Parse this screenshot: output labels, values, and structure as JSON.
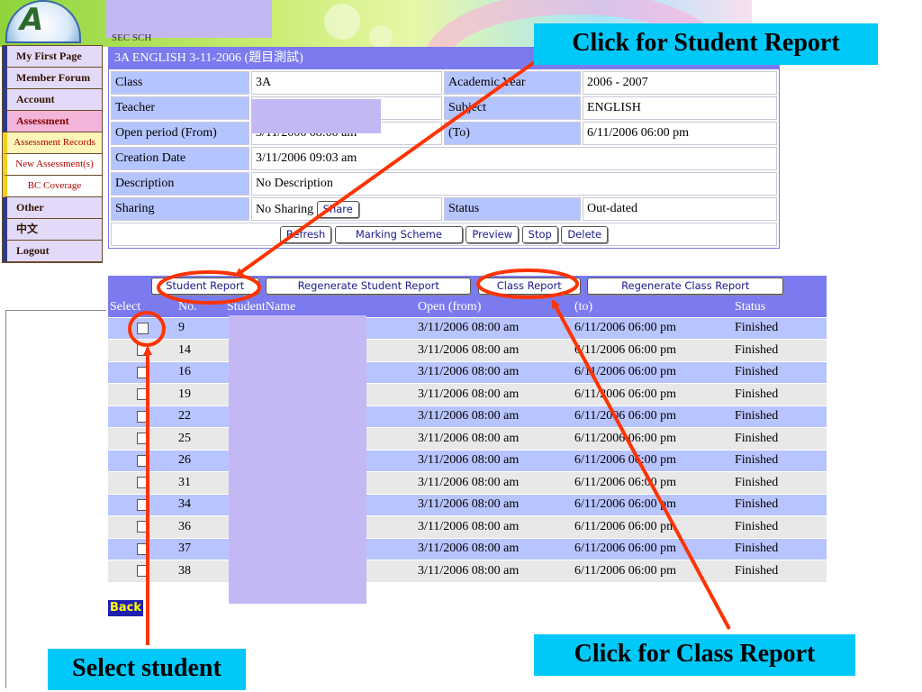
{
  "header": {
    "school_tag": "SEC SCH",
    "logo_text": "A"
  },
  "sidebar": {
    "items": [
      {
        "label": "My First Page"
      },
      {
        "label": "Member Forum"
      },
      {
        "label": "Account"
      },
      {
        "label": "Assessment"
      },
      {
        "label": "Assessment Records"
      },
      {
        "label": "New Assessment(s)"
      },
      {
        "label": "BC Coverage"
      },
      {
        "label": "Other"
      },
      {
        "label": "中文"
      },
      {
        "label": "Logout"
      }
    ]
  },
  "assessment": {
    "title": "3A ENGLISH 3-11-2006 (題目測試)",
    "class_label": "Class",
    "class_value": "3A",
    "year_label": "Academic Year",
    "year_value": "2006 - 2007",
    "teacher_label": "Teacher",
    "teacher_value": "",
    "subject_label": "Subject",
    "subject_value": "ENGLISH",
    "open_from_label": "Open period (From)",
    "open_from_value": "3/11/2006 08:00 am",
    "to_label": "(To)",
    "to_value": "6/11/2006 06:00 pm",
    "creation_label": "Creation Date",
    "creation_value": "3/11/2006 09:03 am",
    "description_label": "Description",
    "description_value": "No Description",
    "sharing_label": "Sharing",
    "sharing_value": "No Sharing",
    "share_button": "Share",
    "status_label": "Status",
    "status_value": "Out-dated",
    "buttons": {
      "refresh": "Refresh",
      "marking_scheme": "Marking Scheme",
      "preview": "Preview",
      "stop": "Stop",
      "delete": "Delete"
    }
  },
  "list": {
    "buttons": {
      "student_report": "Student Report",
      "regen_student": "Regenerate Student Report",
      "class_report": "Class Report",
      "regen_class": "Regenerate Class Report"
    },
    "columns": [
      "Select",
      "No.",
      "StudentName",
      "Open (from)",
      "(to)",
      "Status"
    ],
    "rows": [
      {
        "no": "9",
        "open": "3/11/2006 08:00 am",
        "to": "6/11/2006 06:00 pm",
        "status": "Finished"
      },
      {
        "no": "14",
        "open": "3/11/2006 08:00 am",
        "to": "6/11/2006 06:00 pm",
        "status": "Finished"
      },
      {
        "no": "16",
        "open": "3/11/2006 08:00 am",
        "to": "6/11/2006 06:00 pm",
        "status": "Finished"
      },
      {
        "no": "19",
        "open": "3/11/2006 08:00 am",
        "to": "6/11/2006 06:00 pm",
        "status": "Finished"
      },
      {
        "no": "22",
        "open": "3/11/2006 08:00 am",
        "to": "6/11/2006 06:00 pm",
        "status": "Finished"
      },
      {
        "no": "25",
        "open": "3/11/2006 08:00 am",
        "to": "6/11/2006 06:00 pm",
        "status": "Finished"
      },
      {
        "no": "26",
        "open": "3/11/2006 08:00 am",
        "to": "6/11/2006 06:00 pm",
        "status": "Finished"
      },
      {
        "no": "31",
        "open": "3/11/2006 08:00 am",
        "to": "6/11/2006 06:00 pm",
        "status": "Finished"
      },
      {
        "no": "34",
        "open": "3/11/2006 08:00 am",
        "to": "6/11/2006 06:00 pm",
        "status": "Finished"
      },
      {
        "no": "36",
        "open": "3/11/2006 08:00 am",
        "to": "6/11/2006 06:00 pm",
        "status": "Finished"
      },
      {
        "no": "37",
        "open": "3/11/2006 08:00 am",
        "to": "6/11/2006 06:00 pm",
        "status": "Finished"
      },
      {
        "no": "38",
        "open": "3/11/2006 08:00 am",
        "to": "6/11/2006 06:00 pm",
        "status": "Finished"
      }
    ],
    "back_label": "Back"
  },
  "callouts": {
    "student_report": "Click for Student Report",
    "class_report": "Click for Class Report",
    "select_student": "Select student"
  },
  "colors": {
    "accent": "#7b7bef",
    "callout_bg": "#00c8f8",
    "annotation": "#ff3300"
  }
}
